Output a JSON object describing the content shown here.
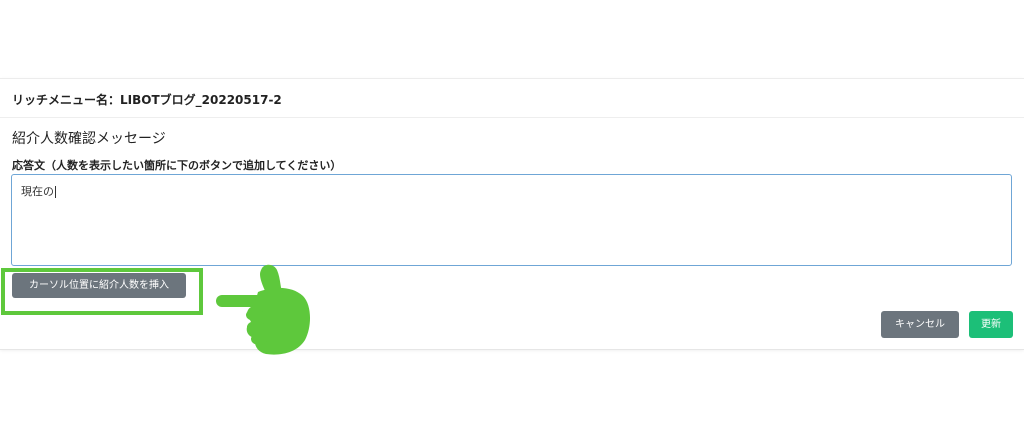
{
  "modal": {
    "title": "リッチメニュー名：LIBOTブログ_20220517-2",
    "section_title": "紹介人数確認メッセージ",
    "field_label": "応答文（人数を表示したい箇所に下のボタンで追加してください）",
    "textarea_value": "現在の",
    "insert_button_label": "カーソル位置に紹介人数を挿入",
    "cancel_button_label": "キャンセル",
    "update_button_label": "更新"
  },
  "annotation": {
    "highlight_color": "#5ec83c",
    "pointer_icon": "pointing-hand-icon"
  },
  "colors": {
    "secondary_button": "#6c757d",
    "primary_button": "#1cbf78",
    "textarea_border": "#6fa6d6"
  }
}
